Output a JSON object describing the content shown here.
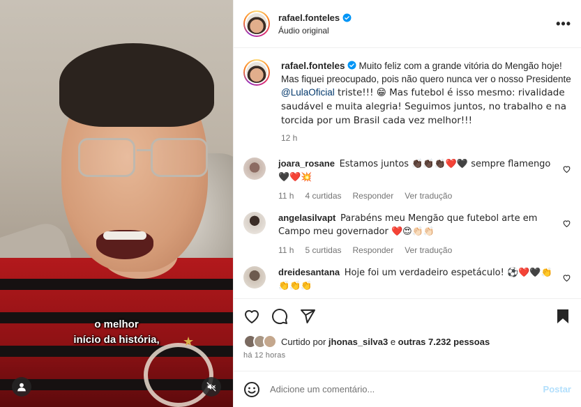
{
  "post": {
    "author": "rafael.fonteles",
    "audio_label": "Áudio original",
    "more_icon": "more-horizontal-icon",
    "caption_user": "rafael.fonteles",
    "caption_part1": "Muito feliz com a grande vitória do Mengão hoje! Mas fiquei preocupado, pois não quero nunca ver o nosso Presidente ",
    "caption_mention": "@LulaOficial",
    "caption_part2": " triste!!! 😁 Mas futebol é isso mesmo: rivalidade saudável e muita alegria! Seguimos juntos, no trabalho e na torcida por um Brasil cada vez melhor!!!",
    "caption_time": "12 h"
  },
  "video": {
    "subtitle_line1": "o melhor",
    "subtitle_line2": "início da história,"
  },
  "comments": [
    {
      "user": "joara_rosane",
      "text": "Estamos juntos 👏🏿👏🏿👏🏿❤️🖤 sempre flamengo 🖤❤️💥",
      "time": "11 h",
      "likes": "4 curtidas",
      "reply": "Responder",
      "translate": "Ver tradução"
    },
    {
      "user": "angelasilvapt",
      "text": "Parabéns meu Mengão que futebol arte em Campo meu governador ❤️😍👏🏻👏🏻",
      "time": "11 h",
      "likes": "5 curtidas",
      "reply": "Responder",
      "translate": "Ver tradução"
    },
    {
      "user": "dreidesantana",
      "text": "Hoje foi um verdadeiro espetáculo! ⚽️❤️🖤👏👏👏👏",
      "time": "",
      "likes": "",
      "reply": "",
      "translate": ""
    }
  ],
  "likes_summary": {
    "prefix": "Curtido por ",
    "user": "jhonas_silva3",
    "middle": " e ",
    "others": "outras 7.232 pessoas"
  },
  "posted_ago": "há 12 horas",
  "comment_box": {
    "placeholder": "Adicione um comentário...",
    "post_label": "Postar"
  },
  "colors": {
    "link": "#00376b",
    "muted": "#737373",
    "verified": "#0095f6",
    "post_disabled": "#b2dffc"
  }
}
